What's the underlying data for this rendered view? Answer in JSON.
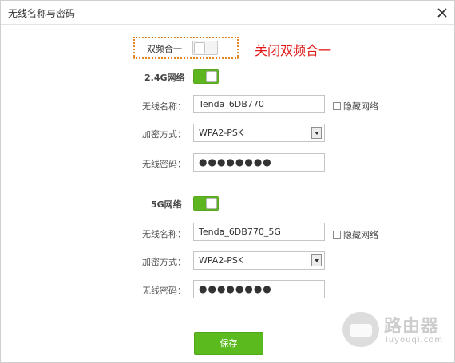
{
  "window": {
    "title": "无线名称与密码",
    "close_icon": "close-icon"
  },
  "dual_band": {
    "label": "双频合一",
    "state": "off"
  },
  "annotation": {
    "text": "关闭双频合一",
    "color": "#e01a1a"
  },
  "band_24": {
    "section_label": "2.4G网络",
    "enabled": true,
    "ssid_label": "无线名称：",
    "ssid_value": "Tenda_6DB770",
    "hide_label": "隐藏网络",
    "hide_checked": false,
    "security_label": "加密方式：",
    "security_value": "WPA2-PSK",
    "password_label": "无线密码：",
    "password_value": "●●●●●●●●"
  },
  "band_5": {
    "section_label": "5G网络",
    "enabled": true,
    "ssid_label": "无线名称：",
    "ssid_value": "Tenda_6DB770_5G",
    "hide_label": "隐藏网络",
    "hide_checked": false,
    "security_label": "加密方式：",
    "security_value": "WPA2-PSK",
    "password_label": "无线密码：",
    "password_value": "●●●●●●●●"
  },
  "actions": {
    "save_label": "保存"
  },
  "watermark": {
    "title": "路由器",
    "subtitle": "luyouqi.com"
  },
  "colors": {
    "toggle_on": "#5db51f",
    "save_button": "#5aba1e",
    "highlight_border": "#e38620"
  }
}
